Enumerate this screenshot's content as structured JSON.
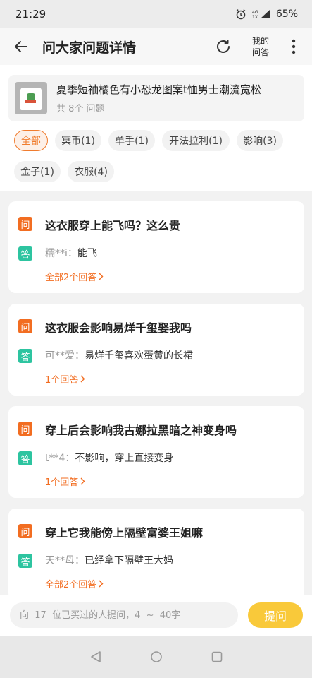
{
  "status_bar": {
    "time": "21:29",
    "network": "4G",
    "battery": "65%"
  },
  "header": {
    "title": "问大家问题详情",
    "my_answers_line1": "我的",
    "my_answers_line2": "问答"
  },
  "product": {
    "title": "夏季短袖橘色有小恐龙图案t恤男士潮流宽松",
    "count_text": "共 8个 问题"
  },
  "tags": [
    {
      "label": "全部",
      "active": true
    },
    {
      "label": "冥币(1)"
    },
    {
      "label": "单手(1)"
    },
    {
      "label": "开法拉利(1)"
    },
    {
      "label": "影响(3)"
    },
    {
      "label": "金子(1)"
    },
    {
      "label": "衣服(4)"
    }
  ],
  "qa": [
    {
      "question": "这衣服穿上能飞吗？这么贵",
      "user": "糯**i：",
      "answer": "能飞",
      "more": "全部2个回答"
    },
    {
      "question": "这衣服会影响易烊千玺娶我吗",
      "user": "可**爱：",
      "answer": "易烊千玺喜欢蛋黄的长裙",
      "more": "1个回答"
    },
    {
      "question": "穿上后会影响我古娜拉黑暗之神变身吗",
      "user": "t**4：",
      "answer": "不影响，穿上直接变身",
      "more": "1个回答"
    },
    {
      "question": "穿上它我能傍上隔壁富婆王姐嘛",
      "user": "天**母：",
      "answer": "已经拿下隔壁王大妈",
      "more": "全部2个回答"
    }
  ],
  "badges": {
    "question": "问",
    "answer": "答"
  },
  "bottom": {
    "placeholder": "向  17  位已买过的人提问，4  ~  40字",
    "ask_label": "提问"
  },
  "colors": {
    "accent_orange": "#f26d21",
    "answer_teal": "#2dc4a0",
    "ask_yellow": "#f9c93a"
  }
}
